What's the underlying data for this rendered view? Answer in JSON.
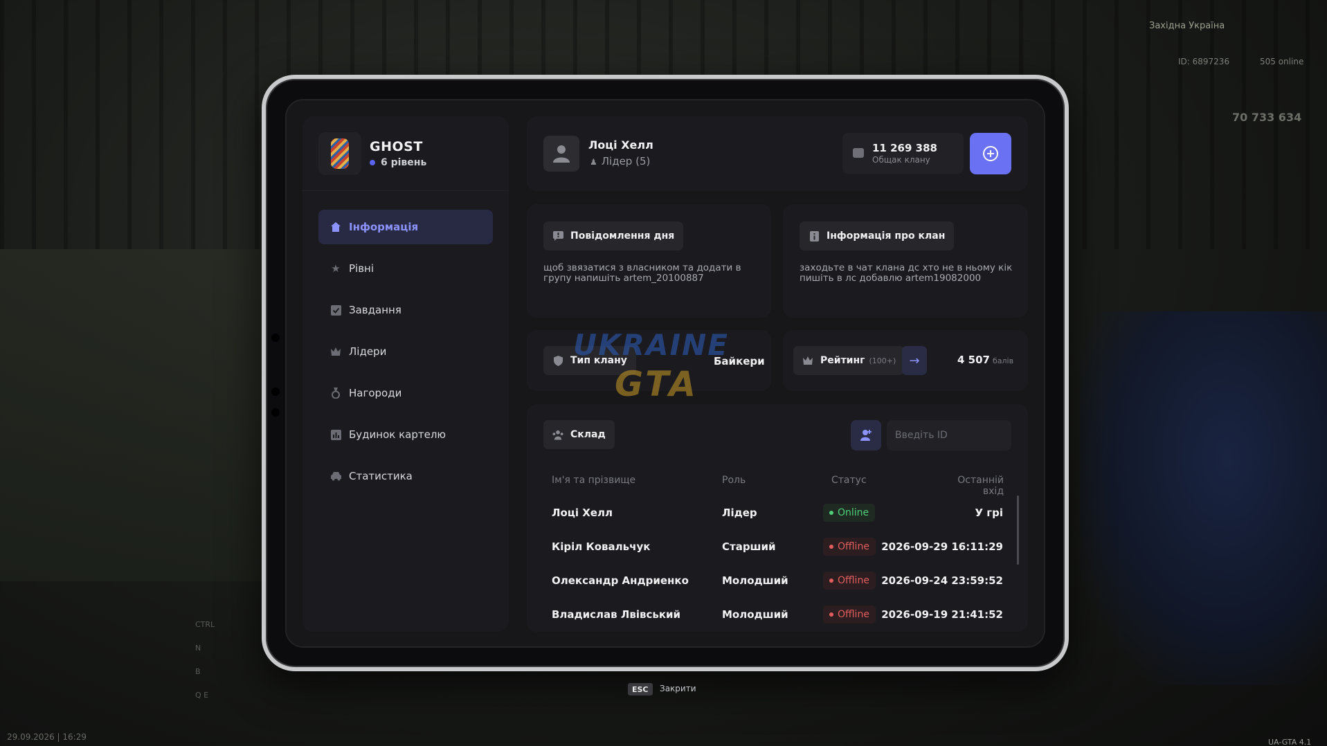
{
  "hud": {
    "region": "Західна Україна",
    "player_id": "ID: 6897236",
    "online": "505 online",
    "money": "70 733 634",
    "datetime": "29.09.2026 | 16:29",
    "version": "UA-GTA 4.1",
    "keys": [
      "CTRL",
      "N",
      "B",
      "Q  E"
    ]
  },
  "profile": {
    "clan_name": "GHOST",
    "level": "6 рівень"
  },
  "sidebar": {
    "items": [
      {
        "label": "Інформація",
        "icon": "home-icon",
        "active": true
      },
      {
        "label": "Рівні",
        "icon": "star-icon"
      },
      {
        "label": "Завдання",
        "icon": "checkbox-icon"
      },
      {
        "label": "Лідери",
        "icon": "crown-icon"
      },
      {
        "label": "Нагороди",
        "icon": "medal-icon"
      },
      {
        "label": "Будинок картелю",
        "icon": "chart-icon"
      },
      {
        "label": "Статистика",
        "icon": "car-icon"
      }
    ]
  },
  "header": {
    "leader_name": "Лоці Хелл",
    "leader_role": "Лідер (5)",
    "bank_amount": "11 269 388",
    "bank_label": "Общак клану"
  },
  "motd": {
    "title": "Повідомлення дня",
    "text_line1": "щоб звязатися з власником та додати в",
    "text_line2": "групу напишіть artem_20100887"
  },
  "clan_info": {
    "title": "Інформація про клан",
    "text_line1": "заходьте в чат клана дс хто не в ньому кік",
    "text_line2": "пишіть в лс добавлю artem19082000"
  },
  "clan_type": {
    "label": "Тип клану",
    "value": "Байкери"
  },
  "rating": {
    "label": "Рейтинг",
    "suffix": "(100+)",
    "points": "4 507",
    "points_unit": "балів"
  },
  "roster": {
    "title": "Склад",
    "id_placeholder": "Введіть ID",
    "columns": [
      "Ім'я та прізвище",
      "Роль",
      "Статус",
      "Останній вхід"
    ],
    "rows": [
      {
        "name": "Лоці Хелл",
        "role": "Лідер",
        "status": "Online",
        "last": "У грі"
      },
      {
        "name": "Кіріл Ковальчук",
        "role": "Старший",
        "status": "Offline",
        "last": "2026-09-29 16:11:29"
      },
      {
        "name": "Олександр Андриенко",
        "role": "Молодший",
        "status": "Offline",
        "last": "2026-09-24 23:59:52"
      },
      {
        "name": "Владислав Лвівський",
        "role": "Молодший",
        "status": "Offline",
        "last": "2026-09-19 21:41:52"
      }
    ]
  },
  "watermark": {
    "line1": "UKRAINE",
    "line2": "GTA"
  },
  "footer": {
    "key": "ESC",
    "label": "Закрити"
  },
  "colors": {
    "accent": "#6a72f3",
    "online": "#4fcf7a",
    "offline": "#e25d5d"
  }
}
